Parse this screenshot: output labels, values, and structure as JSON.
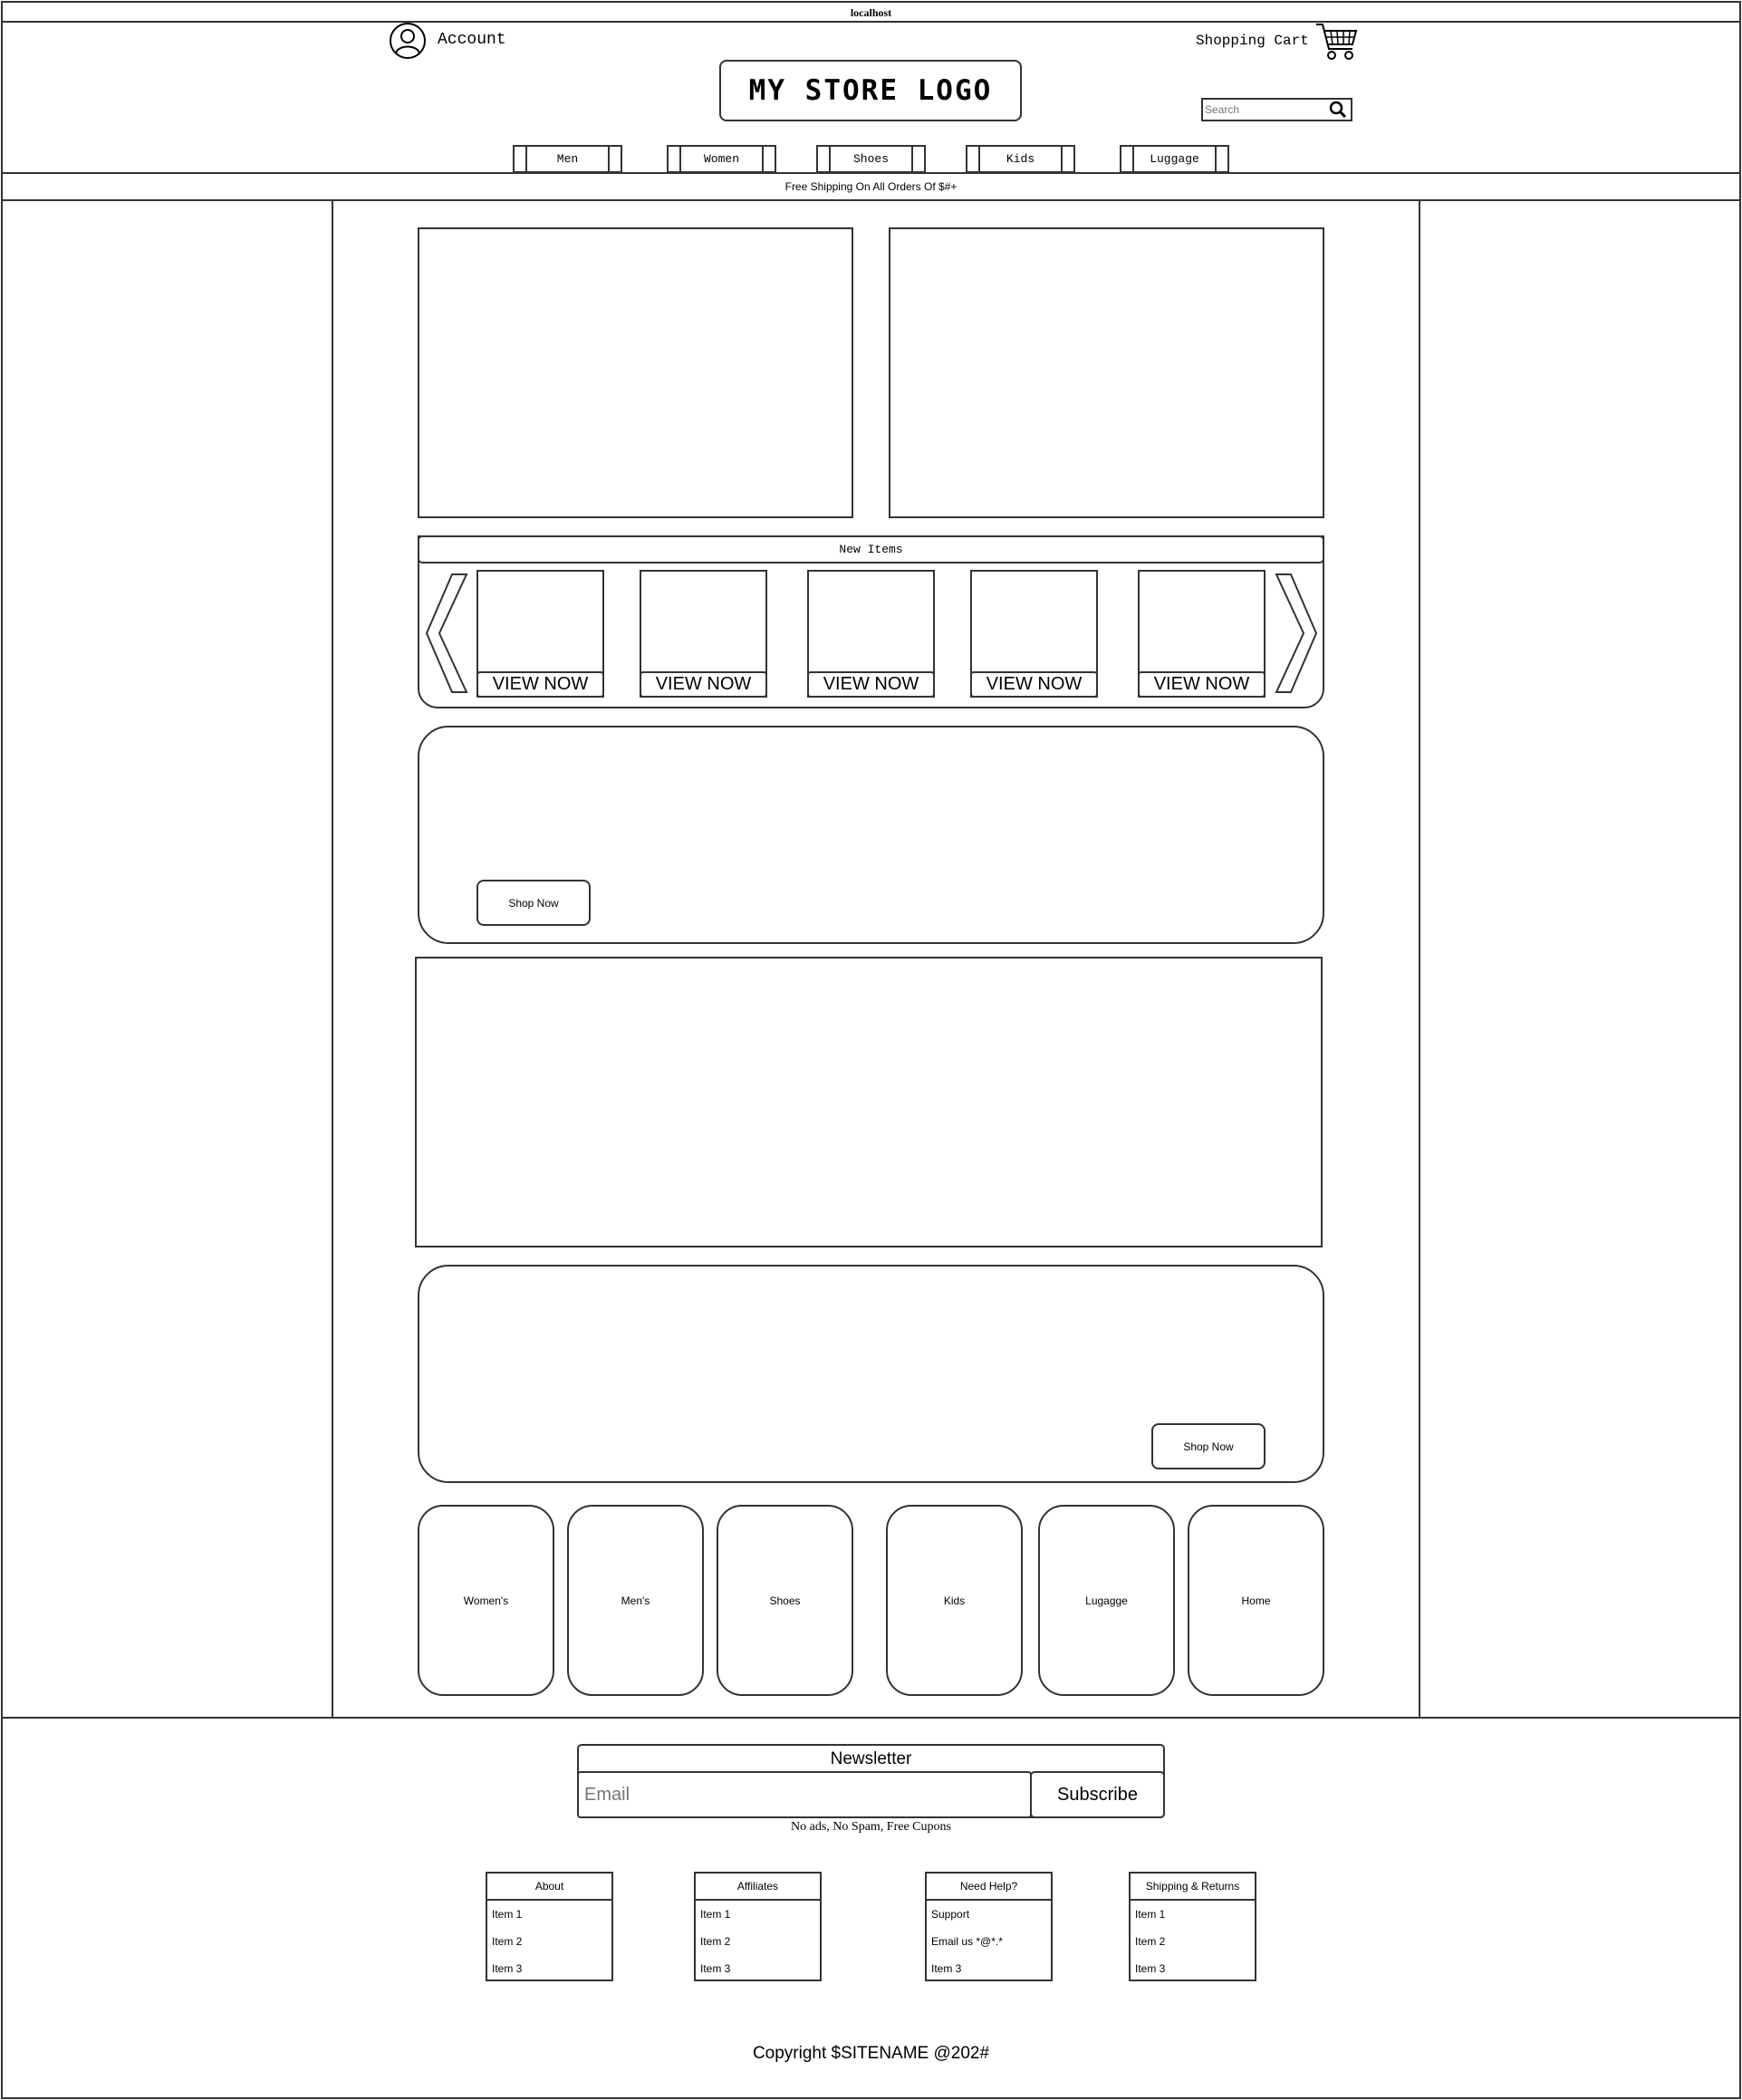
{
  "browser": {
    "url": "localhost"
  },
  "header": {
    "account_label": "Account",
    "cart_label": "Shopping Cart",
    "logo_text": "MY STORE LOGO",
    "search_placeholder": "Search"
  },
  "nav": {
    "items": [
      "Men",
      "Women",
      "Shoes",
      "Kids",
      "Luggage"
    ]
  },
  "banner": {
    "text": "Free Shipping On All Orders Of $#+"
  },
  "new_items": {
    "title": "New Items",
    "button_label": "VIEW NOW"
  },
  "promo1": {
    "button_label": "Shop Now"
  },
  "promo2": {
    "button_label": "Shop Now"
  },
  "categories": [
    "Women's",
    "Men's",
    "Shoes",
    "Kids",
    "Lugagge",
    "Home"
  ],
  "newsletter": {
    "title": "Newsletter",
    "email_placeholder": "Email",
    "subscribe_label": "Subscribe",
    "note": "No ads, No Spam, Free Cupons"
  },
  "footer": {
    "columns": [
      {
        "title": "About",
        "items": [
          "Item 1",
          "Item 2",
          "Item 3"
        ]
      },
      {
        "title": "Affiliates",
        "items": [
          "Item 1",
          "Item 2",
          "Item 3"
        ]
      },
      {
        "title": "Need Help?",
        "items": [
          "Support",
          "Email us *@*.*",
          "Item 3"
        ]
      },
      {
        "title": "Shipping & Returns",
        "items": [
          "Item 1",
          "Item 2",
          "Item 3"
        ]
      }
    ],
    "copyright": "Copyright $SITENAME @202#"
  }
}
